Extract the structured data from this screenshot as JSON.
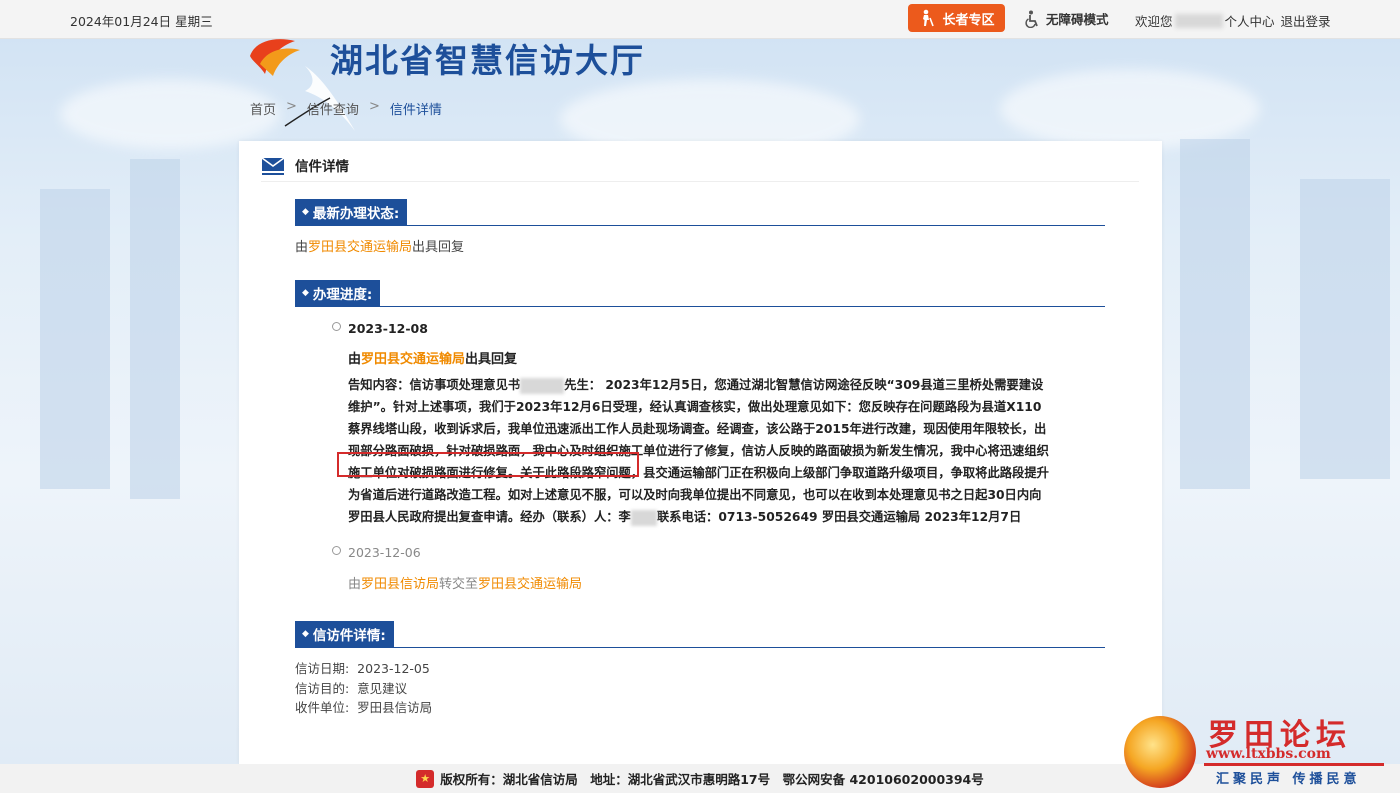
{
  "topbar": {
    "date": "2024年01月24日 星期三",
    "elder_label": "长者专区",
    "accessibility_label": "无障碍模式",
    "welcome_prefix": "欢迎您",
    "personal_center": "个人中心",
    "logout": "退出登录",
    "accent_color": "#ec5a1c"
  },
  "header": {
    "site_title": "湖北省智慧信访大厅",
    "breadcrumb": [
      "首页",
      "信件查询",
      "信件详情"
    ]
  },
  "card": {
    "title": "信件详情",
    "latest_status": {
      "heading": "最新办理状态:",
      "prefix": "由",
      "org": "罗田县交通运输局",
      "suffix": "出具回复"
    },
    "progress": {
      "heading": "办理进度:",
      "entries": [
        {
          "date": "2023-12-08",
          "line_prefix": "由",
          "org": "罗田县交通运输局",
          "line_suffix": "出具回复",
          "notice_1": "告知内容：信访事项处理意见书",
          "notice_2": "先生： 2023年12月5日，您通过湖北智慧信访网途径反映“309县道三里桥处需要建设维护”。针对上述事项，我们于2023年12月6日受理，经认真调查核实，做出处理意见如下：您反映存在问题路段为县道X110蔡界线塔山段，收到诉求后，我单位迅速派出工作人员赴现场调查。经调查，该公路于2015年进行改建，现因使用年限较长，出现部分路面破损，针对破损路面，我中心及时组织施工单位进行了修复，信访人反映的路面破损为新发生情况，",
          "notice_highlight": "我中心将迅速组织施工单位对破损路面进行修复。",
          "notice_3": "关于此路段路窄问题，县交通运输部门正在积极向上级部门争取道路升级项目，争取将此路段提升为省道后进行道路改造工程。如对上述意见不服，可以及时向我单位提出不同意见，也可以在收到本处理意见书之日起30日内向罗田县人民政府提出复查申请。经办（联系）人：李",
          "notice_4": "联系电话：0713-5052649 罗田县交通运输局 2023年12月7日"
        },
        {
          "date": "2023-12-06",
          "line_prefix": "由",
          "org_from": "罗田县信访局",
          "middle": "转交至",
          "org_to": "罗田县交通运输局"
        }
      ]
    },
    "details": {
      "heading": "信访件详情:",
      "date_label": "信访日期:",
      "date_value": "2023-12-05",
      "purpose_label": "信访目的:",
      "purpose_value": "意见建议",
      "unit_label": "收件单位:",
      "unit_value": "罗田县信访局"
    }
  },
  "footer": {
    "text": "版权所有：湖北省信访局　地址：湖北省武汉市惠明路17号　鄂公网安备 42010602000394号"
  },
  "watermark": {
    "name": "罗田论坛",
    "url": "www.ltxbbs.com",
    "slogan": "汇聚民声 传播民意"
  }
}
